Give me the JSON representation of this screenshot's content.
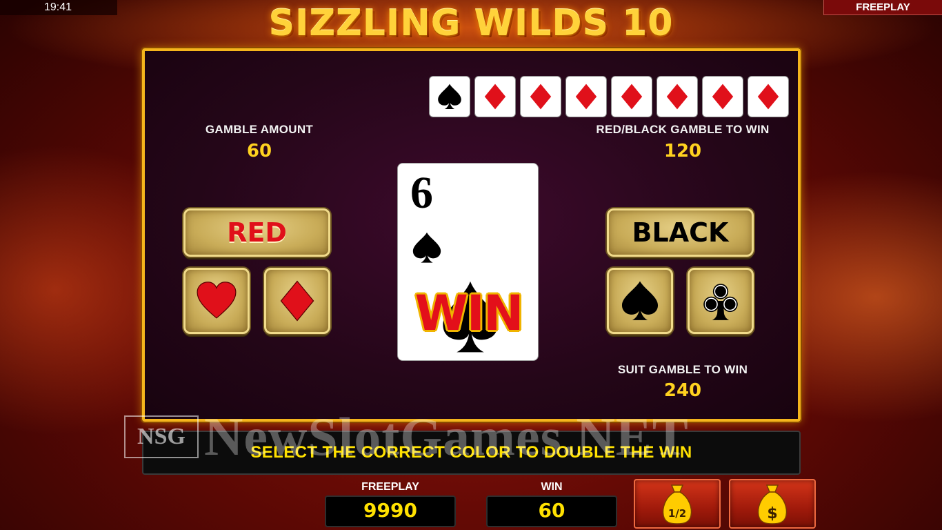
{
  "status_bar": {
    "time": "19:41",
    "mode": "FREEPLAY"
  },
  "game": {
    "title": "SIZZLING WILDS 10"
  },
  "history": {
    "cards": [
      {
        "suit": "spade",
        "color": "#000000"
      },
      {
        "suit": "diamond",
        "color": "#e0101a"
      },
      {
        "suit": "diamond",
        "color": "#e0101a"
      },
      {
        "suit": "diamond",
        "color": "#e0101a"
      },
      {
        "suit": "diamond",
        "color": "#e0101a"
      },
      {
        "suit": "diamond",
        "color": "#e0101a"
      },
      {
        "suit": "diamond",
        "color": "#e0101a"
      },
      {
        "suit": "diamond",
        "color": "#e0101a"
      }
    ]
  },
  "gamble": {
    "amount_label": "GAMBLE AMOUNT",
    "amount_value": "60",
    "color_win_label": "RED/BLACK GAMBLE TO WIN",
    "color_win_value": "120",
    "suit_win_label": "SUIT GAMBLE TO WIN",
    "suit_win_value": "240"
  },
  "buttons": {
    "red_label": "RED",
    "black_label": "BLACK",
    "red_color": "#e0101a",
    "black_color": "#000000",
    "suits_left": [
      "heart",
      "diamond"
    ],
    "suits_right": [
      "spade",
      "club"
    ]
  },
  "card": {
    "rank": "6",
    "suit": "spade",
    "result": "WIN"
  },
  "message": "SELECT THE CORRECT COLOR TO DOUBLE THE WIN",
  "meters": {
    "freeplay_label": "FREEPLAY",
    "freeplay_value": "9990",
    "win_label": "WIN",
    "win_value": "60"
  },
  "collect": {
    "half_icon": "money-bag-half-icon",
    "half_text": "1/2",
    "full_icon": "money-bag-dollar-icon",
    "full_text": "$"
  },
  "watermark": {
    "logo_text": "NSG",
    "text": "NewSlotGames.NET"
  }
}
